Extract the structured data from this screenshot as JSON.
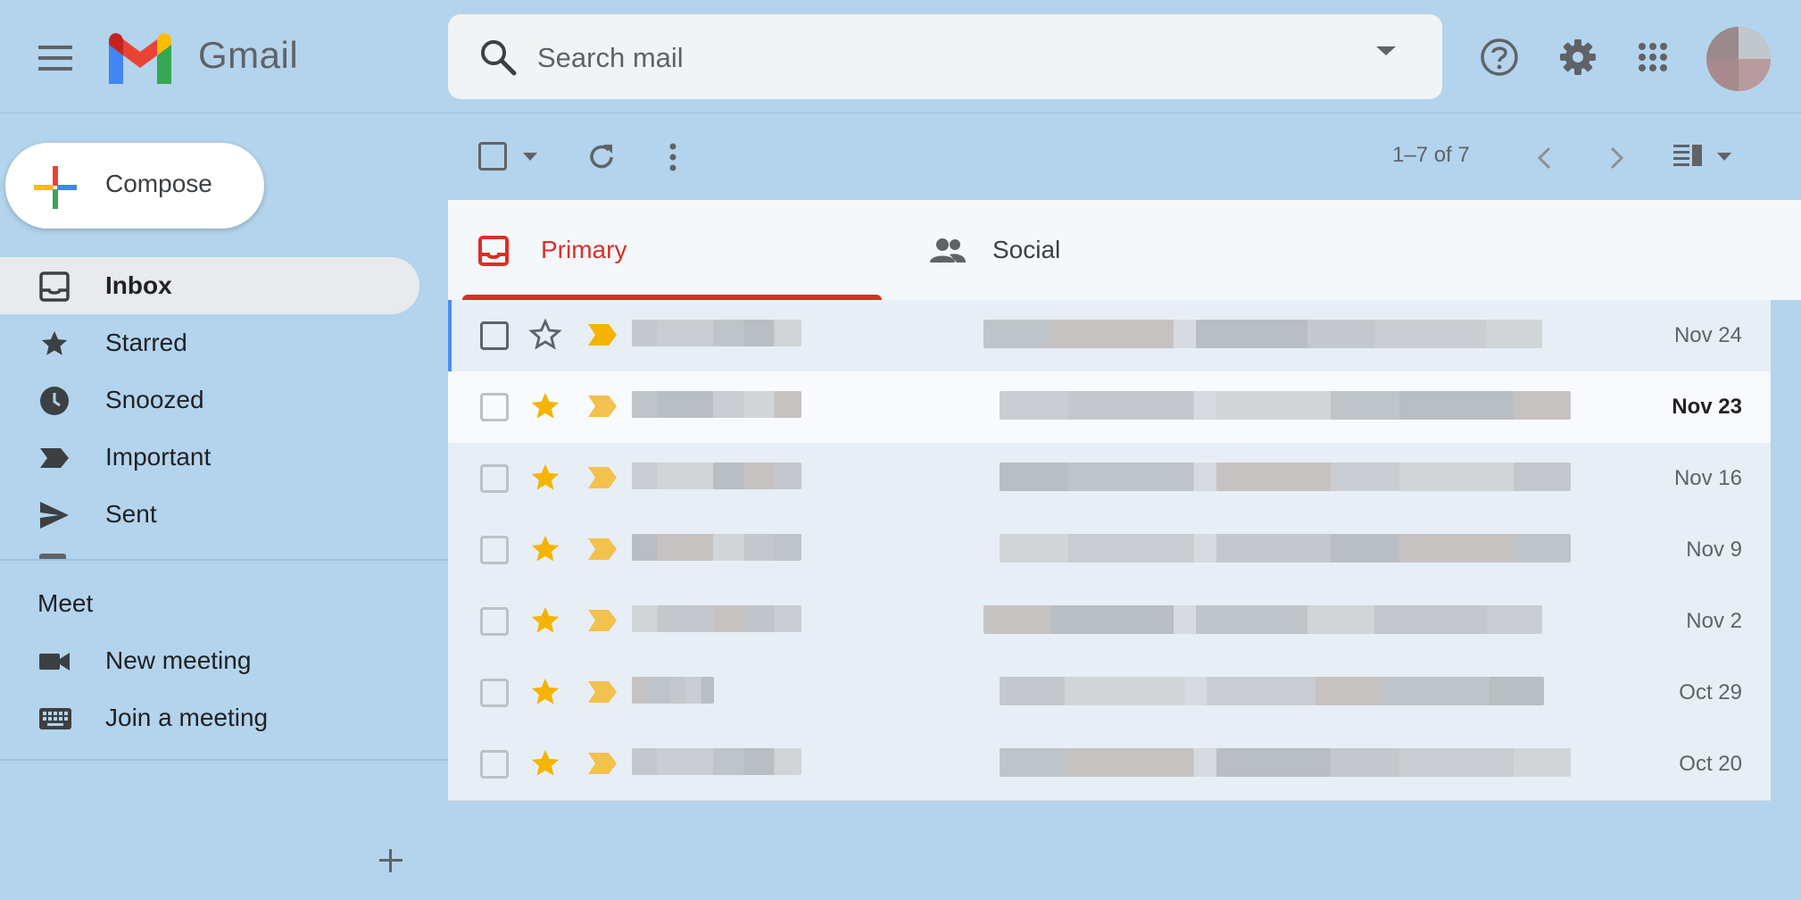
{
  "header": {
    "app_name": "Gmail",
    "menu_icon": "hamburger-menu-icon",
    "search": {
      "placeholder": "Search mail",
      "value": ""
    },
    "icons": [
      "help-icon",
      "settings-gear-icon",
      "apps-grid-icon",
      "account-avatar"
    ]
  },
  "sidebar": {
    "compose_label": "Compose",
    "items": [
      {
        "label": "Inbox",
        "icon": "inbox-icon",
        "active": true
      },
      {
        "label": "Starred",
        "icon": "star-icon"
      },
      {
        "label": "Snoozed",
        "icon": "clock-icon"
      },
      {
        "label": "Important",
        "icon": "important-label-icon"
      },
      {
        "label": "Sent",
        "icon": "send-icon"
      }
    ],
    "meet": {
      "title": "Meet",
      "items": [
        {
          "label": "New meeting",
          "icon": "video-camera-icon"
        },
        {
          "label": "Join a meeting",
          "icon": "keyboard-icon"
        }
      ]
    }
  },
  "toolbar": {
    "pagination": "1–7 of 7"
  },
  "tabs": [
    {
      "label": "Primary",
      "icon": "inbox-icon",
      "active": true
    },
    {
      "label": "Social",
      "icon": "people-icon"
    }
  ],
  "emails": [
    {
      "date": "Nov 24",
      "starred": false,
      "unread": false,
      "selected": true
    },
    {
      "date": "Nov 23",
      "starred": true,
      "unread": true
    },
    {
      "date": "Nov 16",
      "starred": true,
      "unread": false
    },
    {
      "date": "Nov 9",
      "starred": true,
      "unread": false
    },
    {
      "date": "Nov 2",
      "starred": true,
      "unread": false
    },
    {
      "date": "Oct 29",
      "starred": true,
      "unread": false
    },
    {
      "date": "Oct 20",
      "starred": true,
      "unread": false
    }
  ],
  "colors": {
    "background": "#b3d4ec",
    "primary_tab": "#d93025",
    "star": "#f4b400",
    "important_marker": "#f2c14e"
  }
}
